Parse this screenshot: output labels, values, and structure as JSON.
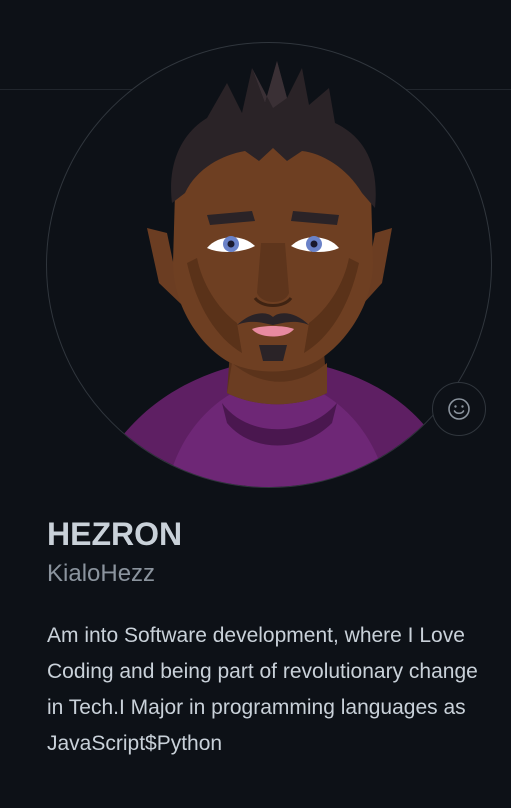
{
  "profile": {
    "name": "HEZRON",
    "login": "KialoHezz",
    "bio": "Am into Software development, where I Love Coding and being part of revolutionary change in Tech.I Major in programming languages as JavaScript$Python"
  },
  "icons": {
    "avatar": "cartoon-avatar-icon",
    "status": "smiley-icon"
  },
  "colors": {
    "background": "#0d1117",
    "border": "#30363d",
    "text_primary": "#c9d1d9",
    "text_muted": "#8b949e"
  }
}
